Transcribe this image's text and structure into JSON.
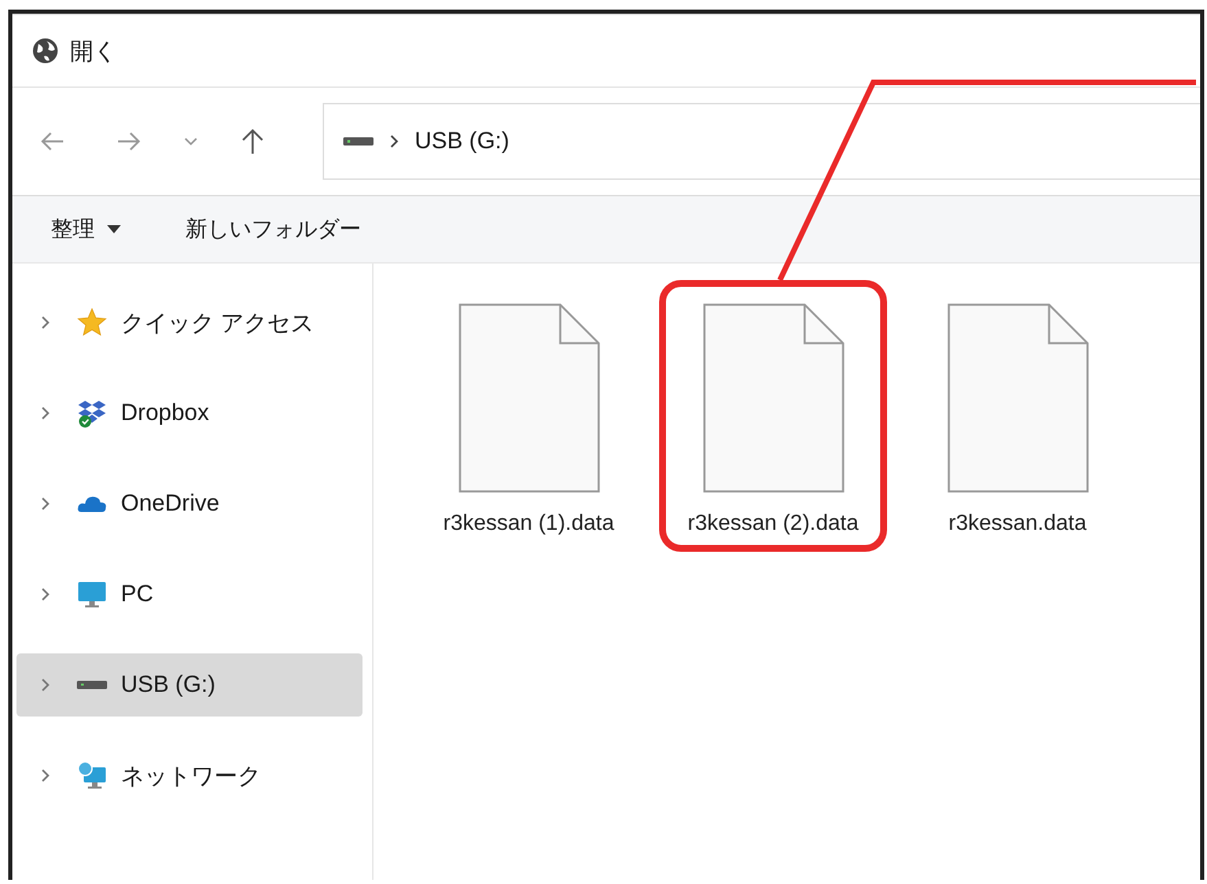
{
  "window": {
    "title": "開く"
  },
  "navigation": {
    "address": {
      "drive_label": "USB (G:)"
    }
  },
  "toolbar": {
    "organize": "整理",
    "new_folder": "新しいフォルダー"
  },
  "sidebar": {
    "items": [
      {
        "kind": "star",
        "label": "クイック アクセス",
        "selected": false,
        "expanded": false
      },
      {
        "kind": "dropbox",
        "label": "Dropbox",
        "selected": false,
        "expanded": false
      },
      {
        "kind": "cloud",
        "label": "OneDrive",
        "selected": false,
        "expanded": false
      },
      {
        "kind": "monitor",
        "label": "PC",
        "selected": false,
        "expanded": false
      },
      {
        "kind": "drive",
        "label": "USB (G:)",
        "selected": true,
        "expanded": false
      },
      {
        "kind": "network",
        "label": "ネットワーク",
        "selected": false,
        "expanded": false
      }
    ]
  },
  "files": [
    {
      "name": "r3kessan (1).data",
      "highlighted": false
    },
    {
      "name": "r3kessan (2).data",
      "highlighted": true
    },
    {
      "name": "r3kessan.data",
      "highlighted": false
    }
  ]
}
